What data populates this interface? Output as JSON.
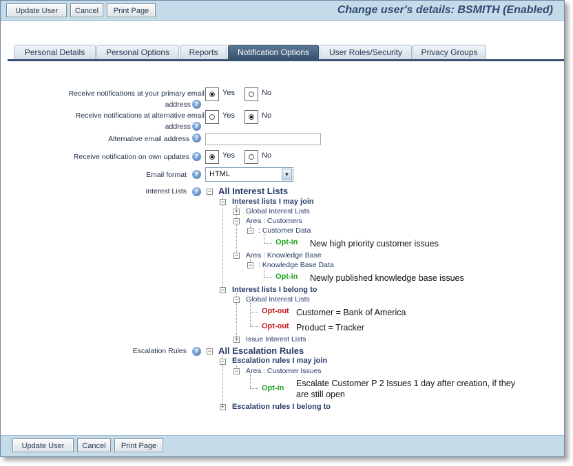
{
  "toolbar": {
    "update_user": "Update User",
    "cancel": "Cancel",
    "print_page": "Print Page"
  },
  "page_title": "Change user's details: BSMITH (Enabled)",
  "tabs": [
    {
      "label": "Personal Details",
      "active": false
    },
    {
      "label": "Personal Options",
      "active": false
    },
    {
      "label": "Reports",
      "active": false
    },
    {
      "label": "Notification Options",
      "active": true
    },
    {
      "label": "User Roles/Security",
      "active": false
    },
    {
      "label": "Privacy Groups",
      "active": false
    }
  ],
  "form": {
    "primary_email": {
      "label_line1": "Receive notifications at your primary email",
      "label_line2": "address",
      "yes": "Yes",
      "no": "No",
      "selected": "Yes"
    },
    "alt_email_notify": {
      "label_line1": "Receive notifications at alternative email",
      "label_line2": "address",
      "yes": "Yes",
      "no": "No",
      "selected": "No"
    },
    "alt_email_address": {
      "label": "Alternative email address",
      "value": ""
    },
    "own_updates": {
      "label": "Receive notification on own updates",
      "yes": "Yes",
      "no": "No",
      "selected": "Yes"
    },
    "email_format": {
      "label": "Email format",
      "value": "HTML"
    },
    "interest_lists": {
      "label": "Interest Lists"
    },
    "escalation_rules": {
      "label": "Escalation Rules"
    }
  },
  "icons": {
    "help": "help-icon",
    "expand": "plus-icon",
    "collapse": "minus-icon",
    "dropdown": "chevron-down-icon"
  },
  "interest_tree": {
    "root": "All Interest Lists",
    "may_join": {
      "label": "Interest lists I may join",
      "global": "Global Interest Lists",
      "area_customers": "Area : Customers",
      "customer_data": ": Customer Data",
      "customer_optin": "Opt-in",
      "customer_desc": "New high priority customer issues",
      "area_kb": "Area : Knowledge Base",
      "kb_data": ": Knowledge Base Data",
      "kb_optin": "Opt-in",
      "kb_desc": "Newly published knowledge base issues"
    },
    "belong_to": {
      "label": "Interest lists I belong to",
      "global": "Global Interest Lists",
      "optout1": "Opt-out",
      "desc1": "Customer = Bank of America",
      "optout2": "Opt-out",
      "desc2": "Product = Tracker",
      "issue_lists": "Issue Interest Lists"
    }
  },
  "escalation_tree": {
    "root": "All Escalation Rules",
    "may_join": {
      "label": "Escalation rules I may join",
      "area": "Area : Customer Issues",
      "optin": "Opt-in",
      "desc_line1": "Escalate Customer P 2 Issues 1 day after creation, if they",
      "desc_line2": "are still open"
    },
    "belong_to": {
      "label": "Escalation rules I belong to"
    }
  },
  "colors": {
    "accent": "#38536f",
    "bar": "#c6dbea",
    "title": "#2d4a70",
    "optin": "#1aa31a",
    "optout": "#c81919",
    "tree_text": "#253a68"
  }
}
